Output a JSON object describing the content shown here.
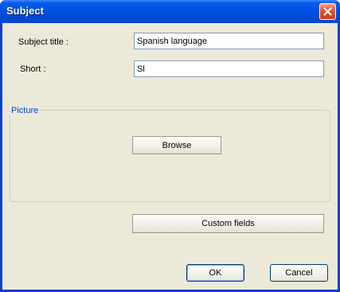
{
  "window": {
    "title": "Subject",
    "close_icon": "close-icon"
  },
  "form": {
    "subject_title_label": "Subject title :",
    "subject_title_value": "Spanish language",
    "short_label": "Short :",
    "short_value": "Sl"
  },
  "picture_group": {
    "legend": "Picture",
    "browse_label": "Browse"
  },
  "custom_fields_label": "Custom fields",
  "footer": {
    "ok_label": "OK",
    "cancel_label": "Cancel"
  },
  "colors": {
    "titlebar": "#0052e6",
    "dialog_bg": "#ece9d8",
    "group_legend": "#0046d5",
    "close_button": "#e0542e"
  }
}
